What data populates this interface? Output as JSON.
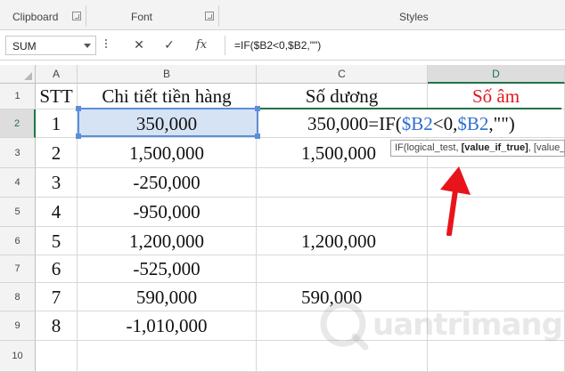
{
  "ribbon": {
    "groups": [
      {
        "label": "Clipboard",
        "launcher": true
      },
      {
        "label": "Font",
        "launcher": true
      },
      {
        "label": "Styles",
        "launcher": false
      }
    ]
  },
  "formula_bar": {
    "name_box": "SUM",
    "cancel_icon": "x-icon",
    "enter_icon": "check-icon",
    "fx_label": "fx",
    "formula": "=IF($B2<0,$B2,\"\")"
  },
  "columns": [
    "A",
    "B",
    "C",
    "D"
  ],
  "rows": [
    {
      "num": "1",
      "a": "STT",
      "b": "Chi tiết tiền hàng",
      "c": "Số dương",
      "d": "Số âm"
    },
    {
      "num": "2",
      "a": "1",
      "b": "350,000",
      "c": "350,000",
      "d": ""
    },
    {
      "num": "3",
      "a": "2",
      "b": "1,500,000",
      "c": "1,500,000",
      "d": ""
    },
    {
      "num": "4",
      "a": "3",
      "b": "-250,000",
      "c": "",
      "d": ""
    },
    {
      "num": "5",
      "a": "4",
      "b": "-950,000",
      "c": "",
      "d": ""
    },
    {
      "num": "6",
      "a": "5",
      "b": "1,200,000",
      "c": "1,200,000",
      "d": ""
    },
    {
      "num": "7",
      "a": "6",
      "b": "-525,000",
      "c": "",
      "d": ""
    },
    {
      "num": "8",
      "a": "7",
      "b": "590,000",
      "c": "590,000",
      "d": ""
    },
    {
      "num": "9",
      "a": "8",
      "b": "-1,010,000",
      "c": "",
      "d": ""
    },
    {
      "num": "10",
      "a": "",
      "b": "",
      "c": "",
      "d": ""
    }
  ],
  "edit": {
    "part1": "=IF(",
    "ref1": "$B2",
    "part2": "<0,",
    "ref2": "$B2",
    "part3": ",\"\")"
  },
  "tooltip": {
    "prefix": "IF(logical_test, ",
    "bold": "[value_if_true]",
    "suffix": ", [value_if_false])"
  },
  "colors": {
    "accent": "#217346",
    "header_red": "#e0191e",
    "ref_blue": "#2e6fd0",
    "selection_fill": "#d6e3f4",
    "arrow_red": "#e8141c"
  },
  "watermark": {
    "text": "uantrimang"
  }
}
